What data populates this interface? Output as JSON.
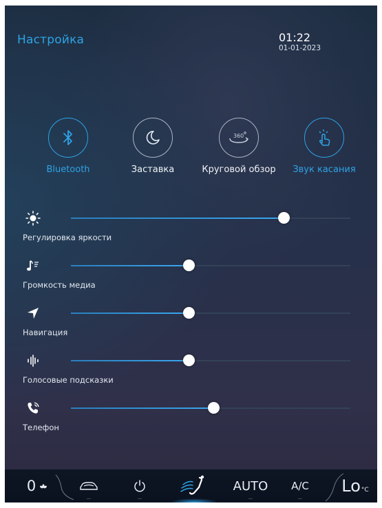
{
  "header": {
    "title": "Настройка",
    "time": "01:22",
    "date": "01-01-2023"
  },
  "quick_buttons": [
    {
      "label": "Bluetooth",
      "icon": "bluetooth-icon",
      "active": true
    },
    {
      "label": "Заставка",
      "icon": "moon-icon",
      "active": false
    },
    {
      "label": "Круговой обзор",
      "icon": "360-view-icon",
      "active": false
    },
    {
      "label": "Звук касания",
      "icon": "touch-sound-icon",
      "active": true
    }
  ],
  "sliders": [
    {
      "label": "Регулировка яркости",
      "icon": "sun-icon",
      "value": 0.76
    },
    {
      "label": "Громкость медиа",
      "icon": "media-note-icon",
      "value": 0.42
    },
    {
      "label": "Навигация",
      "icon": "navigation-arrow-icon",
      "value": 0.42
    },
    {
      "label": "Голосовые подсказки",
      "icon": "voice-wave-icon",
      "value": 0.42
    },
    {
      "label": "Телефон",
      "icon": "phone-icon",
      "value": 0.51
    }
  ],
  "bottom_bar": {
    "fan_level": "0",
    "auto_label": "AUTO",
    "ac_label": "A/C",
    "temp_label": "Lo",
    "temp_unit": "°C"
  },
  "colors": {
    "accent": "#2ea3e6",
    "track": "#334257",
    "fill": "#3aa8f0"
  }
}
